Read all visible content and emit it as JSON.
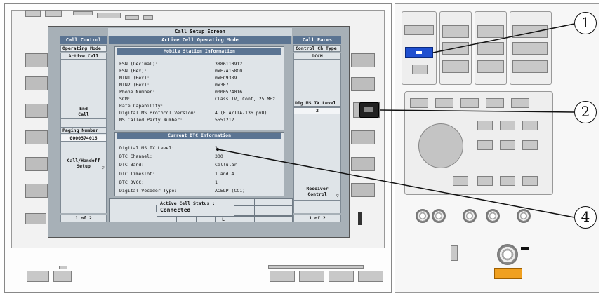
{
  "screen": {
    "title": "Call Setup Screen",
    "left_header": "Call Control",
    "center_header": "Active Cell Operating Mode",
    "right_header": "Call Parms"
  },
  "left_panel": {
    "operating_mode_label": "Operating Mode",
    "operating_mode_value": "Active Cell",
    "end_call_label": "End\nCall",
    "paging_number_label": "Paging Number",
    "paging_number_value": "0000574016",
    "handoff_label": "Call/Handoff\nSetup",
    "page_indicator": "1 of 2"
  },
  "right_panel": {
    "control_ch_label": "Control Ch Type",
    "control_ch_value": "DCCH",
    "dig_ms_tx_label": "Dig MS TX Level",
    "dig_ms_tx_value": "2",
    "receiver_control_label": "Receiver\nControl",
    "page_indicator": "1 of 2"
  },
  "mobile_info": {
    "header": "Mobile Station Information",
    "rows": [
      {
        "label": "ESN (Decimal):",
        "value": "3886110912"
      },
      {
        "label": "ESN (Hex):",
        "value": "0xE7A158C0"
      },
      {
        "label": "MIN1 (Hex):",
        "value": "0xEC9389"
      },
      {
        "label": "MIN2 (Hex):",
        "value": "0x3E7"
      },
      {
        "label": "Phone Number:",
        "value": "0000574016"
      },
      {
        "label": "SCM:",
        "value": "Class IV, Cont, 25 MHz"
      },
      {
        "label": "Rate Capability:",
        "value": ""
      },
      {
        "label": "Digital MS Protocol Version:",
        "value": "4 (EIA/TIA-136 pv0)"
      },
      {
        "label": "MS Called Party Number:",
        "value": "5551212"
      }
    ]
  },
  "dtc_info": {
    "header": "Current DTC Information",
    "rows": [
      {
        "label": "Digital MS TX Level:",
        "value": "2"
      },
      {
        "label": "DTC Channel:",
        "value": "300"
      },
      {
        "label": "DTC Band:",
        "value": "Cellular"
      },
      {
        "label": "DTC Timeslot:",
        "value": "1 and 4"
      },
      {
        "label": "DTC DVCC:",
        "value": "1"
      },
      {
        "label": "Digital Vocoder Type:",
        "value": "ACELP (CC1)"
      }
    ]
  },
  "status": {
    "label": "Active Cell Status :",
    "value": "Connected",
    "indicator_L": "L"
  },
  "callouts": [
    "1",
    "2",
    "4"
  ],
  "colors": {
    "screen_bg": "#a7b0b7",
    "header_blue": "#5b7492",
    "highlight_key": "#1f4fd0",
    "warning_label": "#f0a020"
  }
}
